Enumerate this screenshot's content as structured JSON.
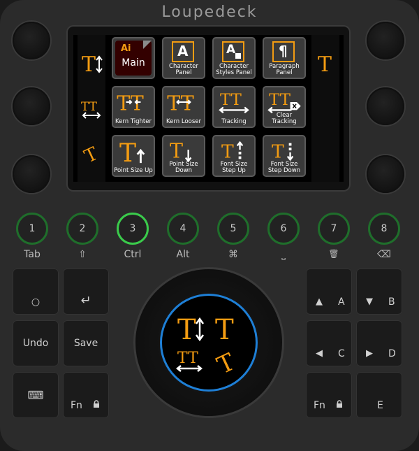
{
  "brand": "Loupedeck",
  "screen": {
    "left_column": [
      {
        "icon": "text-size-vertical-icon",
        "glyph": "T↕"
      },
      {
        "icon": "tracking-icon",
        "glyph": "TT"
      },
      {
        "icon": "rotate-text-icon",
        "glyph": "T"
      }
    ],
    "right_column": [
      {
        "icon": "text-tool-icon",
        "glyph": "T"
      }
    ],
    "tiles": [
      {
        "label": "Main",
        "badge": "Ai",
        "icon": "illustrator-main-icon"
      },
      {
        "label": "Character Panel",
        "glyph": "A",
        "icon": "character-panel-icon"
      },
      {
        "label": "Character Styles Panel",
        "glyph": "A",
        "icon": "character-styles-panel-icon"
      },
      {
        "label": "Paragraph Panel",
        "glyph": "¶",
        "icon": "paragraph-panel-icon"
      },
      {
        "label": "Kern Tighter",
        "glyph": "TT",
        "icon": "kern-tighter-icon"
      },
      {
        "label": "Kern Looser",
        "glyph": "TT",
        "icon": "kern-looser-icon"
      },
      {
        "label": "Tracking",
        "glyph": "TT",
        "icon": "tracking-icon"
      },
      {
        "label": "Clear Tracking",
        "glyph": "TT",
        "icon": "clear-tracking-icon"
      },
      {
        "label": "Point Size Up",
        "glyph": "T",
        "icon": "point-size-up-icon"
      },
      {
        "label": "Point Size Down",
        "glyph": "T",
        "icon": "point-size-down-icon"
      },
      {
        "label": "Font Size Step Up",
        "glyph": "T",
        "icon": "font-size-step-up-icon"
      },
      {
        "label": "Font Size Step Down",
        "glyph": "T",
        "icon": "font-size-step-down-icon"
      }
    ]
  },
  "round_buttons": [
    {
      "num": "1",
      "label": "Tab"
    },
    {
      "num": "2",
      "label": "⇧"
    },
    {
      "num": "3",
      "label": "Ctrl",
      "active": true
    },
    {
      "num": "4",
      "label": "Alt"
    },
    {
      "num": "5",
      "label": "⌘"
    },
    {
      "num": "6",
      "label": "⎵"
    },
    {
      "num": "7",
      "label": "🗑"
    },
    {
      "num": "8",
      "label": "⌫"
    }
  ],
  "left_keys": [
    {
      "label": "○",
      "icon": "circle-icon"
    },
    {
      "label": "↵",
      "icon": "enter-icon"
    },
    {
      "label": "Undo"
    },
    {
      "label": "Save"
    },
    {
      "label": "⌨",
      "icon": "keyboard-icon"
    },
    {
      "label": "Fn",
      "icon": "lock-icon"
    }
  ],
  "right_keys": [
    {
      "arrow": "▲",
      "label": "A"
    },
    {
      "arrow": "▼",
      "label": "B"
    },
    {
      "arrow": "◀",
      "label": "C"
    },
    {
      "arrow": "▶",
      "label": "D"
    },
    {
      "label": "Fn",
      "icon": "lock-icon"
    },
    {
      "label": "E"
    }
  ],
  "dial": {
    "glyphs": [
      "T↕",
      "T",
      "TT",
      "T"
    ]
  },
  "colors": {
    "accent_orange": "#f39c12",
    "active_green": "#3acb4b",
    "inactive_green": "#1f6e2b",
    "dial_ring_blue": "#1e7fd6"
  }
}
